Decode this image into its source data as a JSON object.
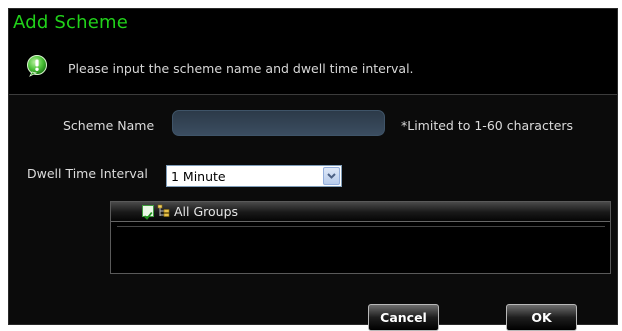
{
  "dialog": {
    "title": "Add Scheme",
    "info_icon": "info-bubble-icon",
    "info_text": "Please input the scheme name and dwell time interval."
  },
  "form": {
    "scheme_name_label": "Scheme Name",
    "scheme_name_value": "",
    "scheme_name_hint": "*Limited to 1-60 characters",
    "dwell_label": "Dwell Time Interval",
    "dwell_selected": "1 Minute"
  },
  "tree": {
    "root_label": "All Groups",
    "root_checked": true,
    "root_icon": "group-tree-icon"
  },
  "buttons": {
    "cancel": "Cancel",
    "ok": "OK"
  },
  "colors": {
    "title": "#21d21a",
    "background": "#000000",
    "checkbox": "#3d9a3c"
  }
}
